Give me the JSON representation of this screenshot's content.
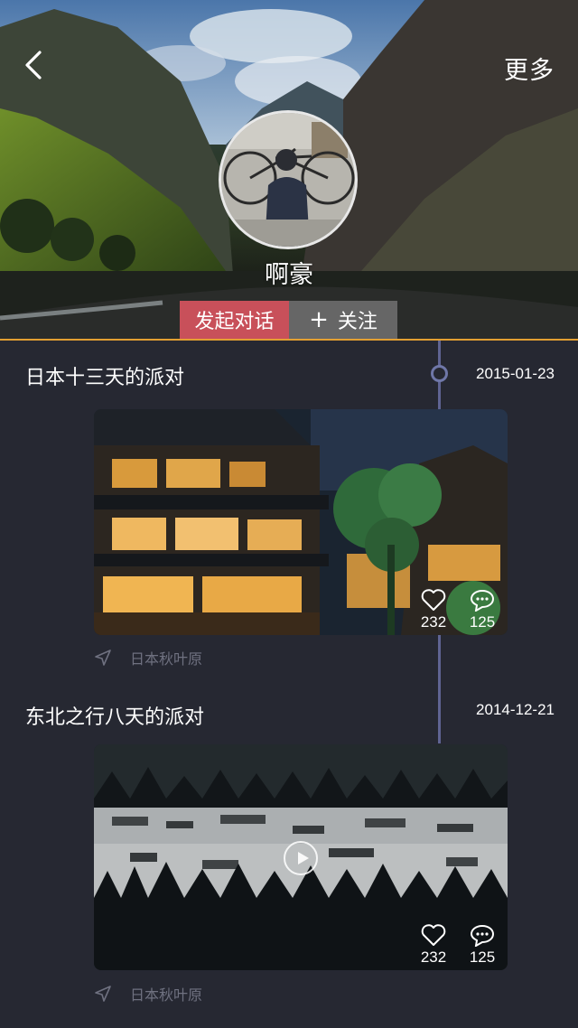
{
  "header": {
    "more_label": "更多",
    "username": "啊豪",
    "chat_button": "发起对话",
    "follow_plus": "+",
    "follow_label": "关注"
  },
  "posts": [
    {
      "title": "日本十三天的派对",
      "date": "2015-01-23",
      "likes": "232",
      "comments": "125",
      "location": "日本秋叶原",
      "is_video": false
    },
    {
      "title": "东北之行八天的派对",
      "date": "2014-12-21",
      "likes": "232",
      "comments": "125",
      "location": "日本秋叶原",
      "is_video": true
    }
  ],
  "colors": {
    "background": "#262832",
    "chat_button": "#c8505a",
    "follow_button": "#6e6e6e",
    "accent_line": "#e3a032",
    "timeline": "#5f6493"
  },
  "icons": [
    "back-arrow-icon",
    "heart-icon",
    "comment-icon",
    "location-arrow-icon",
    "play-icon"
  ]
}
